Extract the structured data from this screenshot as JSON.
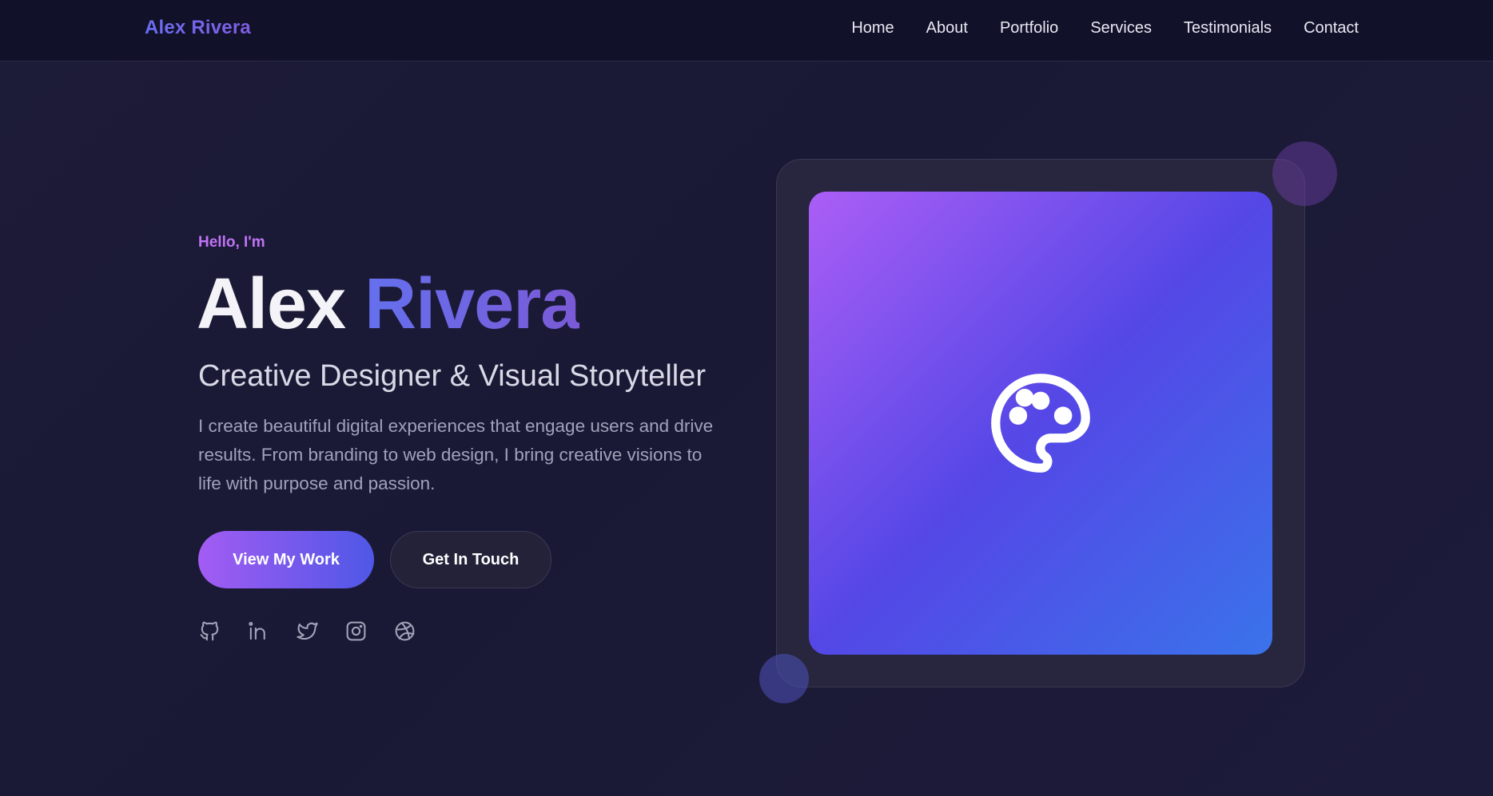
{
  "nav": {
    "brand": "Alex Rivera",
    "links": [
      "Home",
      "About",
      "Portfolio",
      "Services",
      "Testimonials",
      "Contact"
    ]
  },
  "hero": {
    "greeting": "Hello, I'm",
    "first_name": "Alex",
    "last_name": "Rivera",
    "tagline": "Creative Designer & Visual Storyteller",
    "description": "I create beautiful digital experiences that engage users and drive results. From branding to web design, I bring creative visions to life with purpose and passion.",
    "primary_button": "View My Work",
    "secondary_button": "Get In Touch",
    "socials": [
      "github-icon",
      "linkedin-icon",
      "twitter-icon",
      "instagram-icon",
      "dribbble-icon"
    ],
    "card_icon": "palette-icon"
  },
  "colors": {
    "background": "#1b1a36",
    "accent_purple": "#a35cf3",
    "accent_blue": "#4f57e6",
    "greeting": "#c073f5"
  }
}
